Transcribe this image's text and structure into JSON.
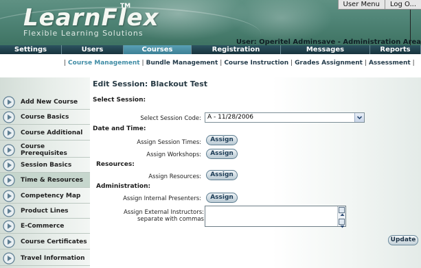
{
  "header": {
    "logo": "LearnFlex",
    "logo_tm": "TM",
    "logo_subtitle": "Flexible Learning Solutions",
    "user_menu": "User Menu",
    "log_off": "Log O...",
    "user_text": "User: Operitel Adminsave - Administration Area"
  },
  "nav": {
    "tabs": [
      {
        "label": "Settings"
      },
      {
        "label": "Users"
      },
      {
        "label": "Courses",
        "active": true
      },
      {
        "label": "Registration"
      },
      {
        "label": "Messages"
      },
      {
        "label": "Reports"
      }
    ]
  },
  "subnav": {
    "links": [
      {
        "label": "Course Management",
        "active": true
      },
      {
        "label": "Bundle Management"
      },
      {
        "label": "Course Instruction"
      },
      {
        "label": "Grades Assignment"
      },
      {
        "label": "Assessment"
      }
    ]
  },
  "sidebar": {
    "items": [
      {
        "label": "Add New Course"
      },
      {
        "label": "Course Basics"
      },
      {
        "label": "Course Additional"
      },
      {
        "label": "Course Prerequisites"
      },
      {
        "label": "Session Basics"
      },
      {
        "label": "Time & Resources",
        "active": true
      },
      {
        "label": "Competency Map"
      },
      {
        "label": "Product Lines"
      },
      {
        "label": "E-Commerce"
      },
      {
        "label": "Course Certificates"
      },
      {
        "label": "Travel Information"
      }
    ]
  },
  "main": {
    "title": "Edit Session: Blackout Test",
    "select_session_heading": "Select Session:",
    "select_session_label": "Select Session Code:",
    "select_session_value": "A - 11/28/2006",
    "date_time_heading": "Date and Time:",
    "assign_session_times_label": "Assign Session Times:",
    "assign_workshops_label": "Assign Workshops:",
    "resources_heading": "Resources:",
    "assign_resources_label": "Assign Resources:",
    "administration_heading": "Administration:",
    "assign_internal_presenters_label": "Assign Internal Presenters:",
    "assign_external_label_1": "Assign External Instructors:",
    "assign_external_label_2": "separate with commas",
    "assign_button": "Assign",
    "update_button": "Update"
  },
  "colors": {
    "header_bg": "#4f8476",
    "nav_bg": "#1d3f4a",
    "nav_active": "#4a90a6",
    "subnav_active": "#3f8ca5"
  }
}
